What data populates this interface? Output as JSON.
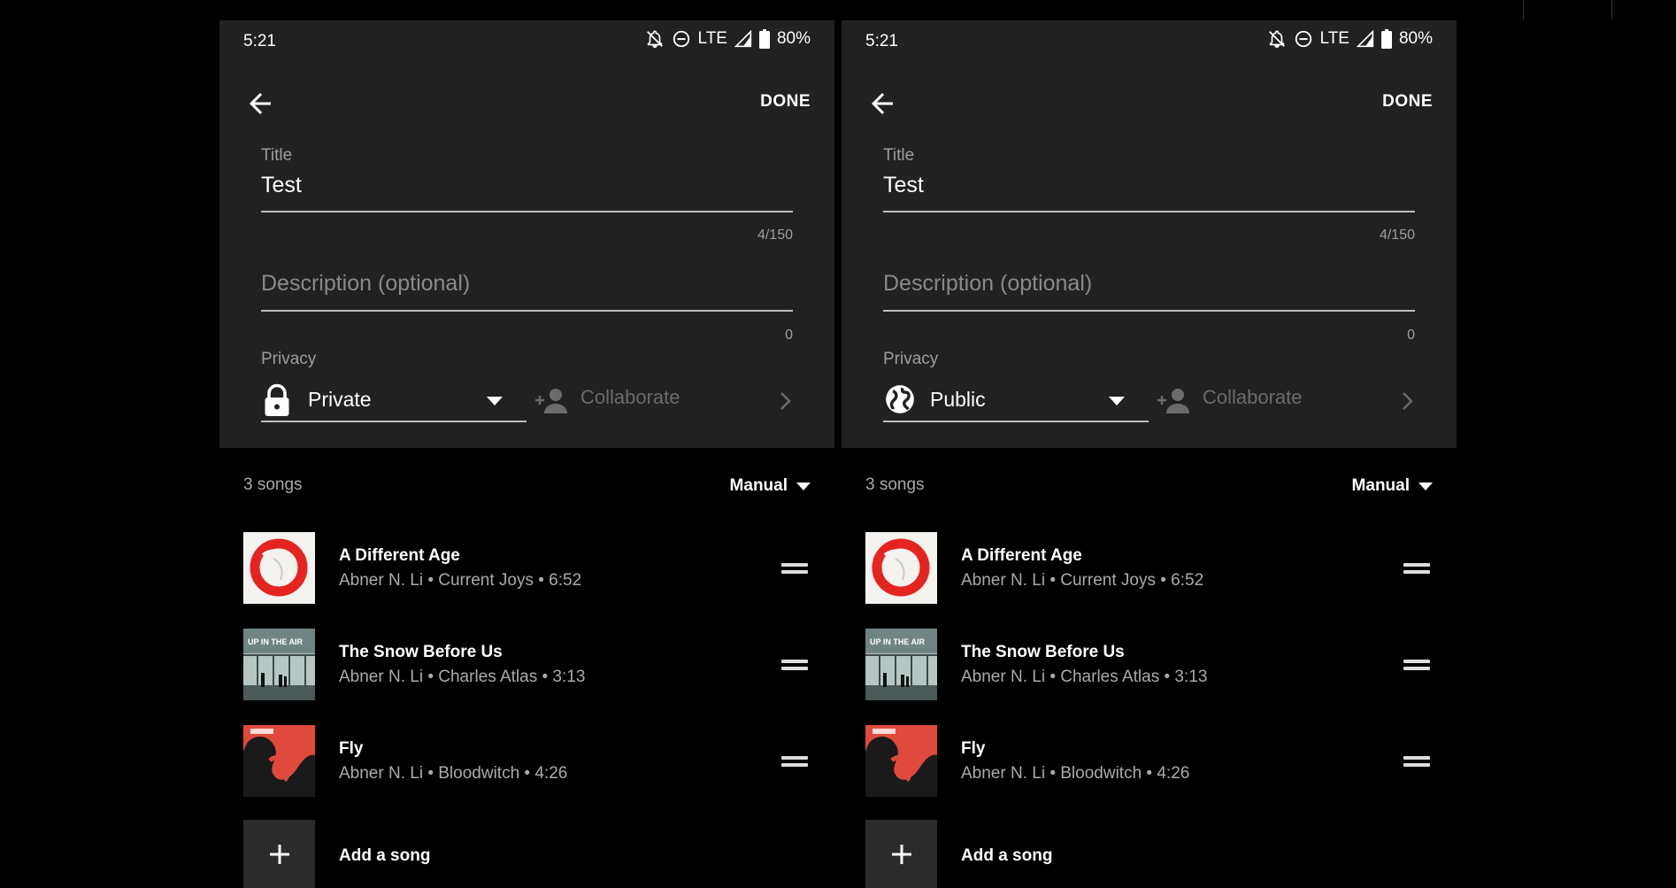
{
  "screens": [
    {
      "status": {
        "time": "5:21",
        "network": "LTE",
        "battery": "80%"
      },
      "header": {
        "done_label": "DONE"
      },
      "title_field": {
        "label": "Title",
        "value": "Test",
        "counter": "4/150"
      },
      "description_field": {
        "placeholder": "Description (optional)",
        "counter": "0"
      },
      "privacy": {
        "label": "Privacy",
        "value": "Private",
        "icon": "lock-icon"
      },
      "collaborate": {
        "label": "Collaborate"
      },
      "songs_header": {
        "count": "3 songs",
        "sort_label": "Manual"
      },
      "songs": [
        {
          "title": "A Different Age",
          "subtitle": "Abner N. Li • Current Joys • 6:52"
        },
        {
          "title": "The Snow Before Us",
          "subtitle": "Abner N. Li • Charles Atlas • 3:13",
          "art_text": "UP IN THE AIR"
        },
        {
          "title": "Fly",
          "subtitle": "Abner N. Li • Bloodwitch • 4:26"
        }
      ],
      "add_song": {
        "label": "Add a song"
      }
    },
    {
      "status": {
        "time": "5:21",
        "network": "LTE",
        "battery": "80%"
      },
      "header": {
        "done_label": "DONE"
      },
      "title_field": {
        "label": "Title",
        "value": "Test",
        "counter": "4/150"
      },
      "description_field": {
        "placeholder": "Description (optional)",
        "counter": "0"
      },
      "privacy": {
        "label": "Privacy",
        "value": "Public",
        "icon": "globe-icon"
      },
      "collaborate": {
        "label": "Collaborate"
      },
      "songs_header": {
        "count": "3 songs",
        "sort_label": "Manual"
      },
      "songs": [
        {
          "title": "A Different Age",
          "subtitle": "Abner N. Li • Current Joys • 6:52"
        },
        {
          "title": "The Snow Before Us",
          "subtitle": "Abner N. Li • Charles Atlas • 3:13",
          "art_text": "UP IN THE AIR"
        },
        {
          "title": "Fly",
          "subtitle": "Abner N. Li • Bloodwitch • 4:26"
        }
      ],
      "add_song": {
        "label": "Add a song"
      }
    }
  ],
  "colors": {
    "panel_bg": "#212121",
    "page_bg": "#000000",
    "muted_text": "#9e9e9e",
    "accent_red": "#e53935"
  }
}
